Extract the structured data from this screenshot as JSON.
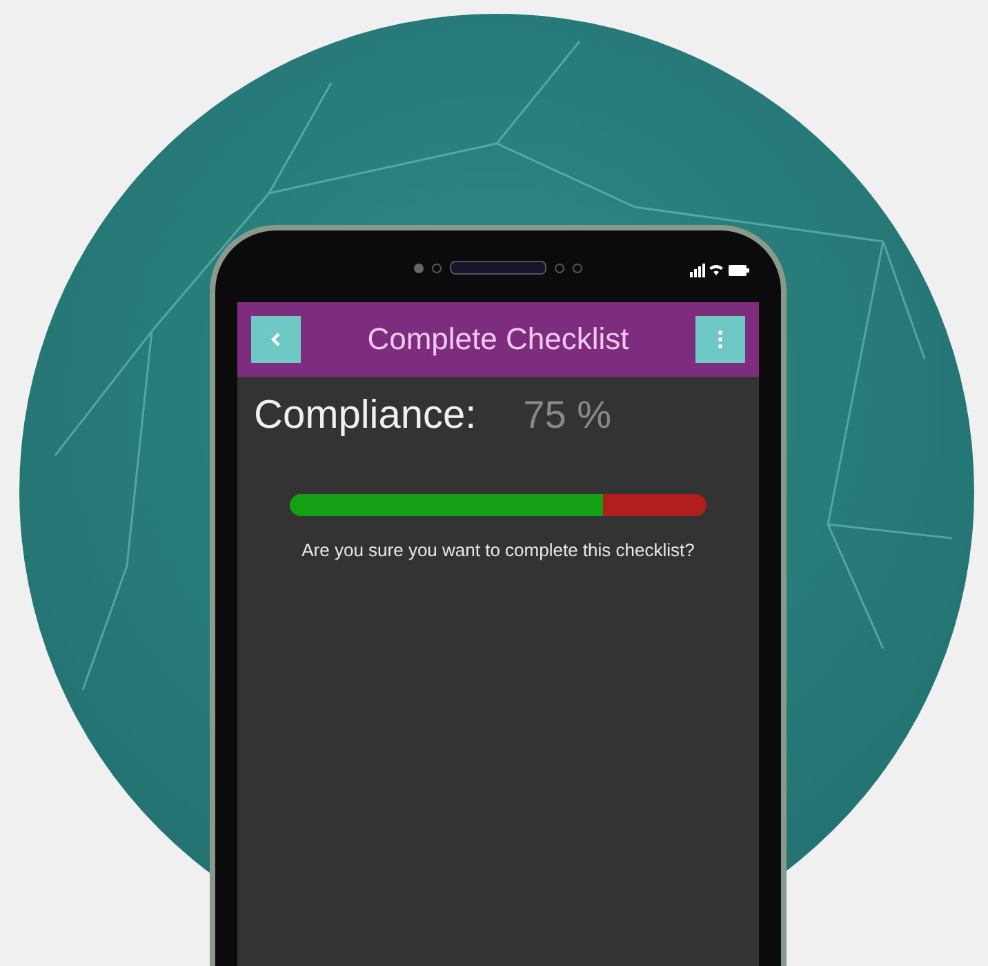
{
  "app_bar": {
    "title": "Complete Checklist"
  },
  "compliance": {
    "label": "Compliance:",
    "value": "75 %",
    "level": 0.75
  },
  "message": "Are you sure you want to complete this checklist?"
}
